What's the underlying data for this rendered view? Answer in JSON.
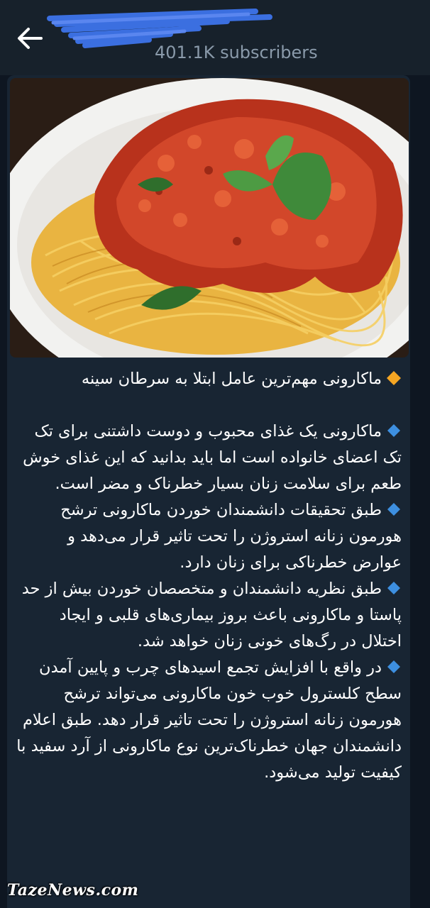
{
  "header": {
    "channel_title": "",
    "subscribers": "401.1K subscribers"
  },
  "message": {
    "title": "ماکارونی مهم‌ترین عامل ابتلا به سرطان سینه",
    "paragraphs": [
      "ماکارونی یک غذای محبوب و دوست داشتنی برای تک تک اعضای خانواده است اما باید بدانید که این غذای خوش طعم برای سلامت زنان بسیار خطرناک و مضر است.",
      "طبق تحقیقات دانشمندان خوردن ماکارونی ترشح هورمون زنانه استروژن را تحت تاثیر قرار می‌دهد و عوارض خطرناکی برای زنان دارد.",
      "طبق نظریه دانشمندان و متخصصان خوردن بیش از حد پاستا و ماکارونی باعث بروز بیماری‌های قلبی و ایجاد اختلال در رگ‌های خونی زنان خواهد شد.",
      "در واقع با افزایش تجمع اسیدهای چرب و پایین آمدن سطح کلسترول خوب خون ماکارونی می‌تواند ترشح هورمون زنانه استروژن را تحت تاثیر قرار دهد. طبق اعلام دانشمندان جهان خطرناک‌ترین نوع ماکارونی از آرد سفید با کیفیت تولید می‌شود."
    ]
  },
  "watermark": "TazeNews.com",
  "colors": {
    "header_bg": "#17212b",
    "chat_bg": "#0e1621",
    "bubble_bg": "#182533",
    "title_bullet": "#f5a623",
    "para_bullet": "#3d8fe0"
  }
}
